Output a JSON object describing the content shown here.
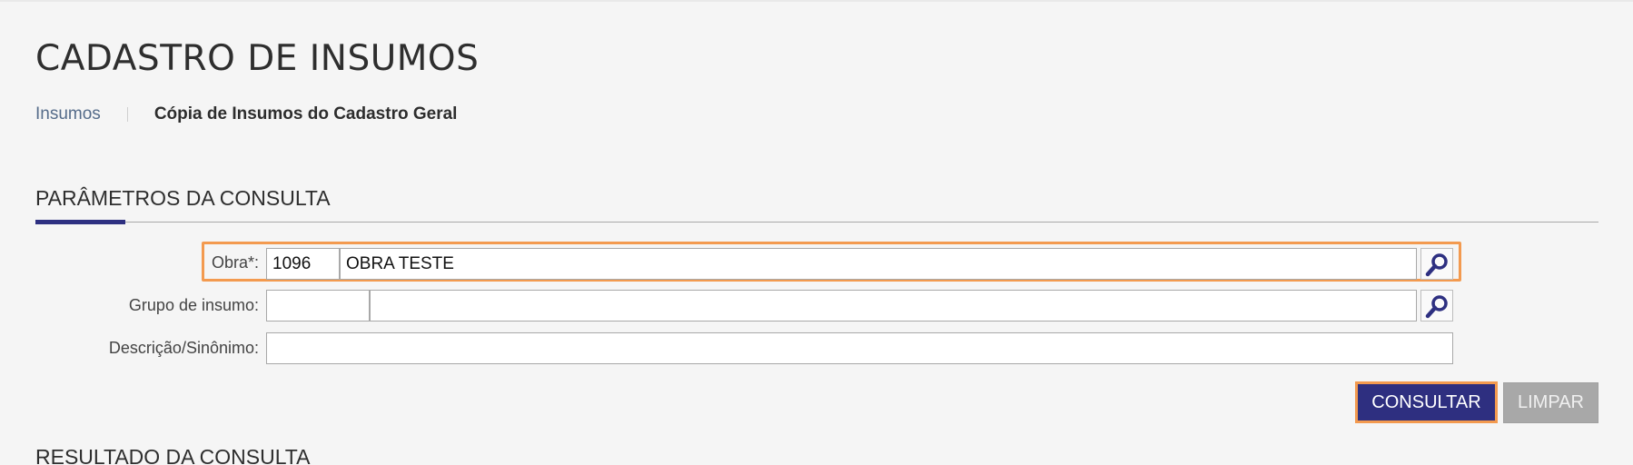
{
  "header": {
    "title": "CADASTRO DE INSUMOS"
  },
  "breadcrumb": {
    "items": [
      {
        "label": "Insumos"
      },
      {
        "label": "Cópia de Insumos do Cadastro Geral"
      }
    ]
  },
  "parameters": {
    "section_title": "PARÂMETROS DA CONSULTA",
    "obra": {
      "label": "Obra*:",
      "code_value": "1096",
      "name_value": "OBRA TESTE",
      "search_icon": "magnifier-icon"
    },
    "grupo": {
      "label": "Grupo de insumo:",
      "code_value": "",
      "name_value": "",
      "search_icon": "magnifier-icon"
    },
    "descricao": {
      "label": "Descrição/Sinônimo:",
      "value": ""
    },
    "buttons": {
      "consultar_label": "CONSULTAR",
      "limpar_label": "LIMPAR"
    }
  },
  "results": {
    "section_title": "RESULTADO DA CONSULTA"
  },
  "colors": {
    "accent": "#2e3081",
    "highlight": "#f39a4f",
    "background": "#f5f5f5"
  }
}
